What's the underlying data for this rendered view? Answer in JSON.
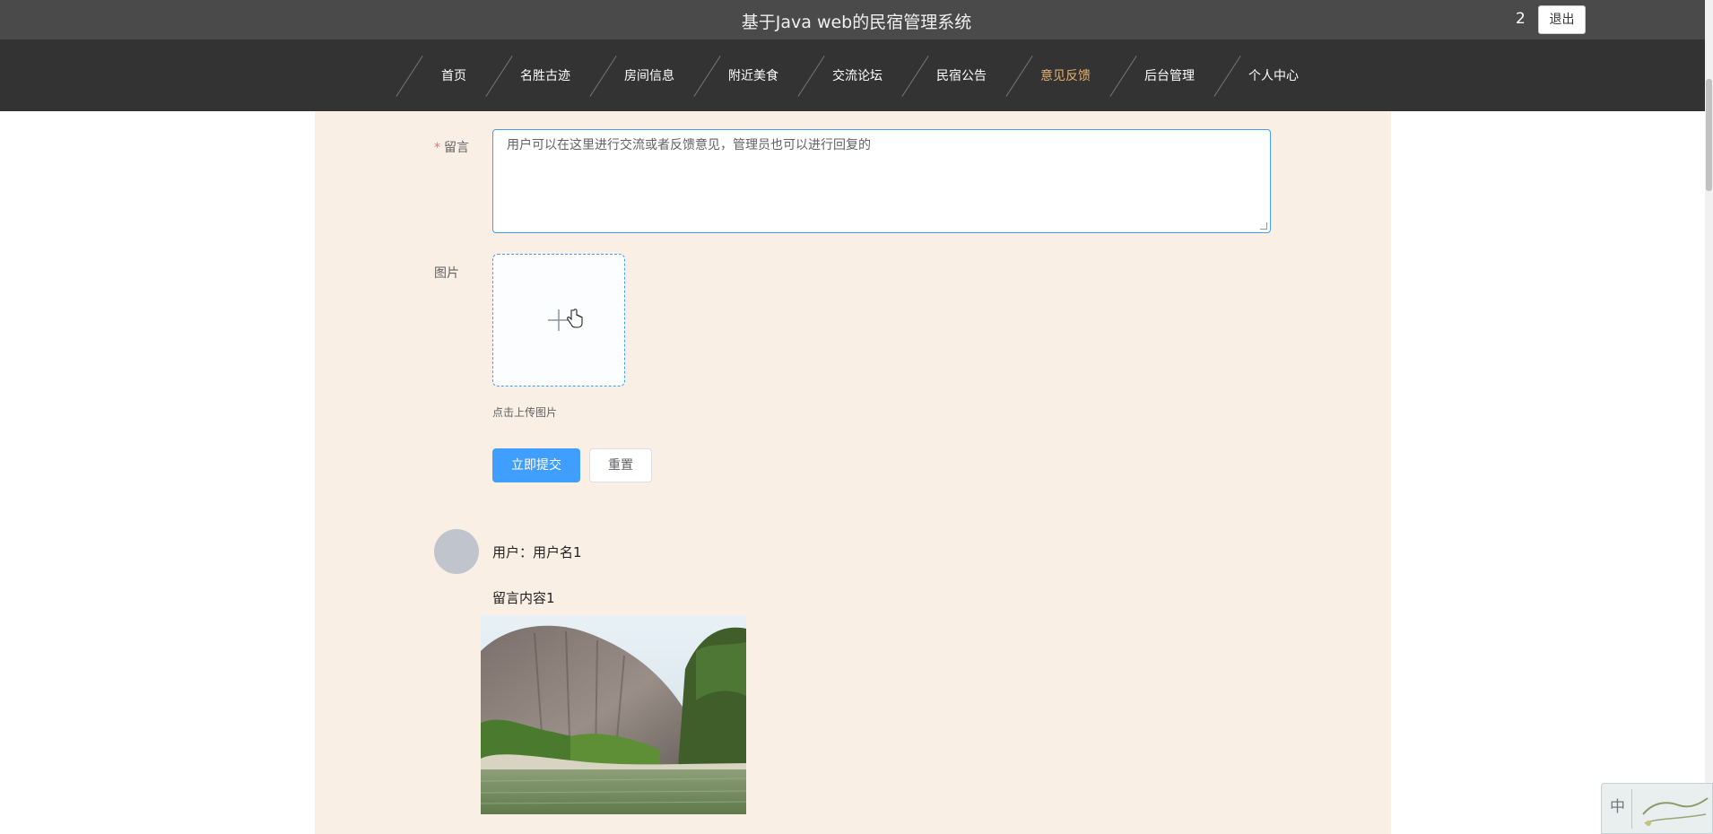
{
  "header": {
    "title": "基于Java web的民宿管理系统",
    "user_number": "2",
    "logout_label": "退出"
  },
  "nav": {
    "items": [
      {
        "label": "首页"
      },
      {
        "label": "名胜古迹"
      },
      {
        "label": "房间信息"
      },
      {
        "label": "附近美食"
      },
      {
        "label": "交流论坛"
      },
      {
        "label": "民宿公告"
      },
      {
        "label": "意见反馈",
        "active": true
      },
      {
        "label": "后台管理"
      },
      {
        "label": "个人中心"
      }
    ],
    "active_color": "#e0b071"
  },
  "page": {
    "title": "意见反馈"
  },
  "form": {
    "message": {
      "required_mark": "*",
      "label": "留言",
      "value": "用户可以在这里进行交流或者反馈意见，管理员也可以进行回复的"
    },
    "image": {
      "label": "图片",
      "upload_tip": "点击上传图片",
      "icon": "plus-icon"
    },
    "submit_label": "立即提交",
    "reset_label": "重置",
    "accent_color": "#409eff"
  },
  "comments": [
    {
      "user_label": "用户：用户名1",
      "content": "留言内容1"
    }
  ],
  "ime": {
    "char": "中"
  }
}
